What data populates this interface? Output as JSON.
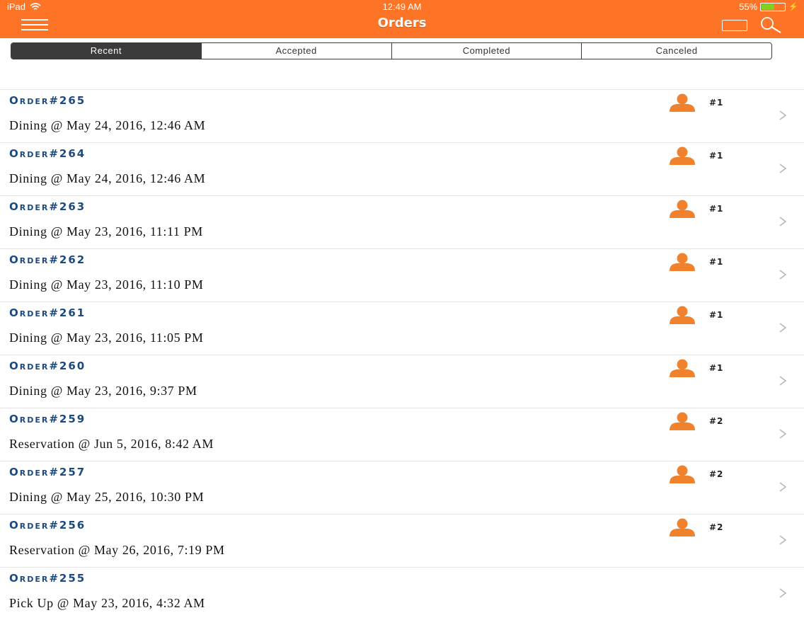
{
  "status_bar": {
    "device": "iPad",
    "time": "12:49 AM",
    "battery": "55%",
    "battery_level": 0.55,
    "battery_color": "#7ed321"
  },
  "nav": {
    "title": "Orders",
    "menu_icon": "hamburger-icon",
    "folder_icon": "folder-icon",
    "search_icon": "search-icon",
    "bar_color": "#fd7427"
  },
  "tabs": [
    {
      "label": "Recent",
      "active": true
    },
    {
      "label": "Accepted",
      "active": false
    },
    {
      "label": "Completed",
      "active": false
    },
    {
      "label": "Canceled",
      "active": false
    }
  ],
  "orders": [
    {
      "id": "Order#265",
      "detail": "Dining @ May 24, 2016, 12:46 AM",
      "guests": "#1"
    },
    {
      "id": "Order#264",
      "detail": "Dining @ May 24, 2016, 12:46 AM",
      "guests": "#1"
    },
    {
      "id": "Order#263",
      "detail": "Dining @ May 23, 2016, 11:11 PM",
      "guests": "#1"
    },
    {
      "id": "Order#262",
      "detail": "Dining @ May 23, 2016, 11:10 PM",
      "guests": "#1"
    },
    {
      "id": "Order#261",
      "detail": "Dining @ May 23, 2016, 11:05 PM",
      "guests": "#1"
    },
    {
      "id": "Order#260",
      "detail": "Dining @ May 23, 2016, 9:37 PM",
      "guests": "#1"
    },
    {
      "id": "Order#259",
      "detail": "Reservation @ Jun 5, 2016, 8:42 AM",
      "guests": "#2"
    },
    {
      "id": "Order#257",
      "detail": "Dining @ May 25, 2016, 10:30 PM",
      "guests": "#2"
    },
    {
      "id": "Order#256",
      "detail": "Reservation @ May 26, 2016, 7:19 PM",
      "guests": "#2"
    },
    {
      "id": "Order#255",
      "detail": "Pick Up @ May 23, 2016, 4:32 AM",
      "guests": ""
    }
  ],
  "colors": {
    "order_id": "#1c4a7e",
    "person_icon": "#f0822e"
  }
}
